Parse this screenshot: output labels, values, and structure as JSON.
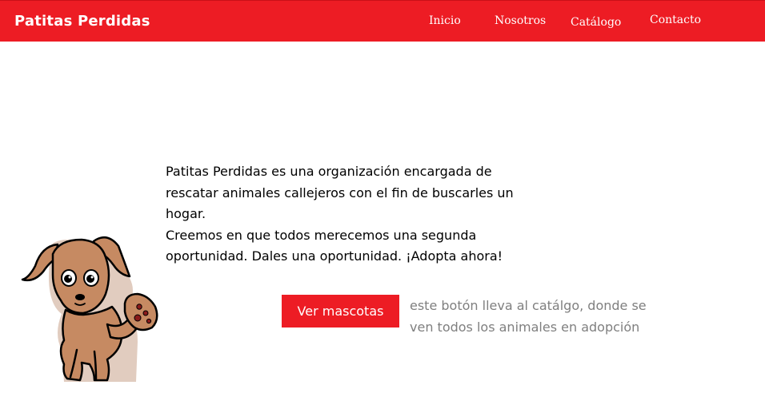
{
  "navbar": {
    "brand": "Patitas Perdidas",
    "links": [
      {
        "label": "Inicio"
      },
      {
        "label": "Nosotros"
      },
      {
        "label": "Catálogo"
      },
      {
        "label": "Contacto"
      }
    ],
    "background_color": "#ed1c24"
  },
  "main": {
    "intro_line_1": "Patitas Perdidas es una organización encargada de rescatar animales callejeros con el fin de buscarles un hogar.",
    "intro_line_2": "Creemos en que todos merecemos una segunda oportunidad. Dales una oportunidad. ¡Adopta ahora!",
    "cta_button_label": "Ver mascotas",
    "cta_note": "este botón lleva al catálgo, donde se ven todos los animales en adopción"
  },
  "mascot": {
    "icon": "dog-waving-icon"
  },
  "colors": {
    "accent": "#ed1c24",
    "note_text": "#7f7f7f",
    "dog_fur": "#c68a62"
  }
}
